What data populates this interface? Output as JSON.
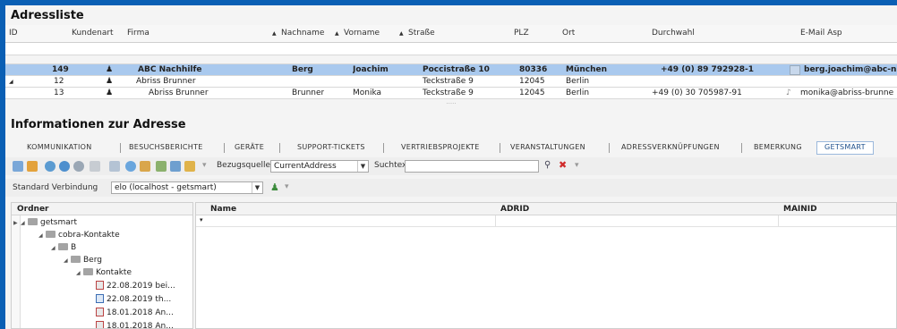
{
  "addresses": {
    "title": "Adressliste",
    "columns": {
      "id": "ID",
      "kundenart": "Kundenart",
      "firma": "Firma",
      "nachname": "Nachname",
      "vorname": "Vorname",
      "strasse": "Straße",
      "plz": "PLZ",
      "ort": "Ort",
      "durchwahl": "Durchwahl",
      "email": "E-Mail Asp"
    },
    "rows": [
      {
        "id": "149",
        "firma": "ABC Nachhilfe",
        "nachname": "Berg",
        "vorname": "Joachim",
        "strasse": "Poccistraße 10",
        "plz": "80336",
        "ort": "München",
        "durchwahl": "+49 (0) 89 792928-1",
        "email": "berg.joachim@abc-n"
      },
      {
        "id": "12",
        "firma": "Abriss Brunner",
        "nachname": "",
        "vorname": "",
        "strasse": "Teckstraße 9",
        "plz": "12045",
        "ort": "Berlin",
        "durchwahl": "",
        "email": ""
      },
      {
        "id": "13",
        "firma": "Abriss Brunner",
        "nachname": "Brunner",
        "vorname": "Monika",
        "strasse": "Teckstraße 9",
        "plz": "12045",
        "ort": "Berlin",
        "durchwahl": "+49 (0) 30 705987-91",
        "email": "monika@abriss-brunne"
      }
    ],
    "splitter_dots": "....."
  },
  "info": {
    "title": "Informationen zur Adresse",
    "tabs": [
      "KOMMUNIKATION",
      "BESUCHSBERICHTE",
      "GERÄTE",
      "SUPPORT-TICKETS",
      "VERTRIEBSPROJEKTE",
      "VERANSTALTUNGEN",
      "ADRESSVERKNÜPFUNGEN",
      "BEMERKUNG",
      "GETSMART"
    ],
    "active_tab": "GETSMART"
  },
  "toolbar": {
    "bezugsquelle_label": "Bezugsquelle:",
    "bezugsquelle_value": "CurrentAddress",
    "suchtext_label": "Suchtext",
    "suchtext_value": "",
    "verbindung_label": "Standard Verbindung",
    "verbindung_value": "elo (localhost - getsmart)"
  },
  "folders": {
    "header": "Ordner",
    "tree": [
      "getsmart",
      "cobra-Kontakte",
      "B",
      "Berg",
      "Kontakte",
      "22.08.2019 bei...",
      "22.08.2019 th...",
      "18.01.2018 An...",
      "18.01.2018 An..."
    ]
  },
  "documents": {
    "columns": {
      "name": "Name",
      "adrid": "ADRID",
      "mainid": "MAINID"
    }
  },
  "colors": {
    "frame_blue": "#0a5fb4",
    "selected_row": "#a9c9ee",
    "active_tab_text": "#1d4f8c"
  }
}
